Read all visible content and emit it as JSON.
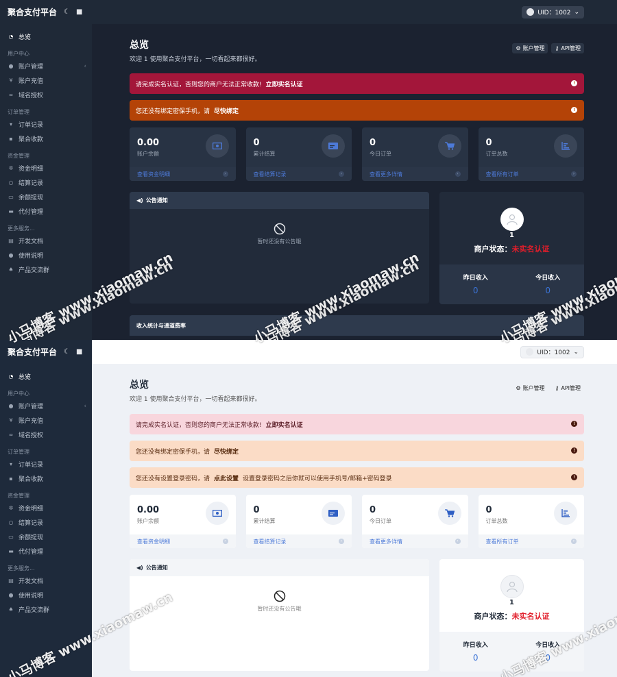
{
  "brand": {
    "name": "聚合支付平台"
  },
  "topbar": {
    "uid_label": "UID：1002"
  },
  "nav": {
    "overview": "总览",
    "sec_user": "用户中心",
    "account_mgmt": "账户管理",
    "recharge": "账户充值",
    "domain_auth": "域名授权",
    "sec_order": "订单管理",
    "order_record": "订单记录",
    "aggregate_collect": "聚合收款",
    "sec_fund": "资金管理",
    "fund_detail": "资金明细",
    "settle_record": "结算记录",
    "balance_withdraw": "余额提现",
    "proxy_pay": "代付管理",
    "sec_more": "更多服务...",
    "dev_docs": "开发文档",
    "usage_guide": "使用说明",
    "product_group": "产品交流群"
  },
  "page": {
    "title": "总览",
    "subtitle": "欢迎 1 使用聚合支付平台，一切看起来都很好。",
    "btn_account": "账户管理",
    "btn_api": "API管理"
  },
  "alerts": {
    "realname_text": "请完成实名认证，否则您的商户无法正常收款!",
    "realname_link": "立即实名认证",
    "phone_text": "您还没有绑定密保手机，请",
    "phone_link": "尽快绑定",
    "pwd_text": "您还没有设置登录密码，请",
    "pwd_link": "点此设置",
    "pwd_tail": "设置登录密码之后你就可以使用手机号/邮箱+密码登录"
  },
  "stats": [
    {
      "value": "0.00",
      "label": "账户余额",
      "link": "查看资金明细"
    },
    {
      "value": "0",
      "label": "累计结算",
      "link": "查看结算记录"
    },
    {
      "value": "0",
      "label": "今日订单",
      "link": "查看更多详情"
    },
    {
      "value": "0",
      "label": "订单总数",
      "link": "查看所有订单"
    }
  ],
  "notice": {
    "title": "公告通知",
    "empty": "暂时还没有公告哦"
  },
  "merchant": {
    "num": "1",
    "status_label": "商户状态：",
    "status_value": "未实名认证",
    "yesterday_label": "昨日收入",
    "yesterday_value": "0",
    "today_label": "今日收入",
    "today_value": "0"
  },
  "income": {
    "title": "收入统计与通道费率"
  },
  "watermark": "小马博客 www.xiaomaw.cn",
  "colors": {
    "accent": "#3b73d6",
    "danger": "#e11d2a",
    "sidebar": "#1f2937"
  }
}
